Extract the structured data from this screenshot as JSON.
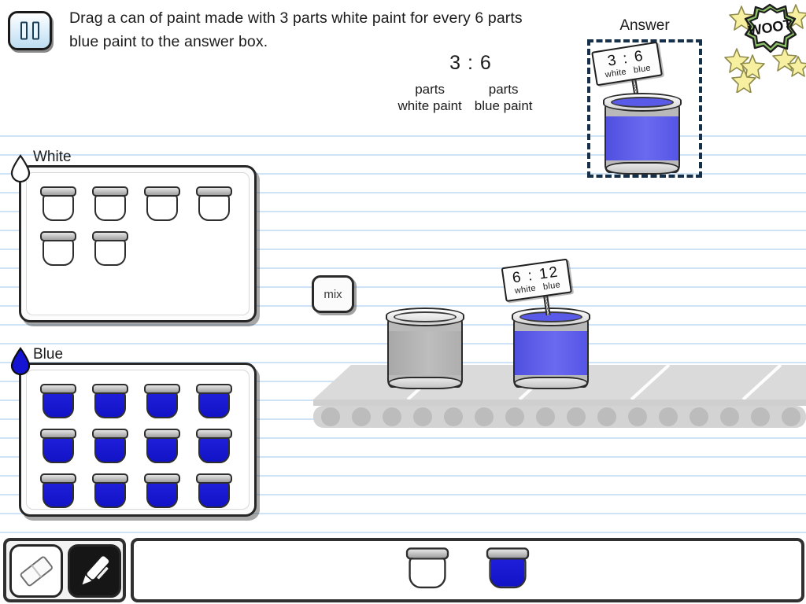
{
  "header": {
    "pause_icon": "pause-icon",
    "instruction": "Drag a can of paint made with 3 parts white paint for every 6 parts blue paint to the answer box.",
    "ratio": {
      "value": "3 : 6",
      "left_label_line1": "parts",
      "left_label_line2": "white paint",
      "right_label_line1": "parts",
      "right_label_line2": "blue paint"
    }
  },
  "answer": {
    "label": "Answer",
    "can": {
      "fill": "blue",
      "sign_nums": "3 : 6",
      "sign_left_label": "white",
      "sign_right_label": "blue"
    }
  },
  "badge": {
    "text": "WOOT",
    "star_color": "#f6ef9a"
  },
  "white_tray": {
    "title": "White",
    "drop_icon": "water-drop-outline-icon",
    "jar_count": 6,
    "jar_fill": "white"
  },
  "blue_tray": {
    "title": "Blue",
    "drop_icon": "water-drop-filled-icon",
    "jar_count": 12,
    "jar_fill": "blue"
  },
  "workspace": {
    "mix_button_label": "mix",
    "cans": [
      {
        "fill": "gray",
        "has_sign": false
      },
      {
        "fill": "blue",
        "has_sign": true,
        "sign_nums": "6 : 12",
        "sign_left_label": "white",
        "sign_right_label": "blue"
      }
    ]
  },
  "toolbar": {
    "tools": [
      {
        "name": "eraser",
        "selected": false
      },
      {
        "name": "pen",
        "selected": true
      }
    ],
    "tray_jars": [
      {
        "fill": "white"
      },
      {
        "fill": "blue"
      }
    ]
  },
  "colors": {
    "paint_blue_can": "#5a5ae8",
    "paint_blue_jar": "#1414d2",
    "paper_line": "#cfe3f7",
    "outline": "#262626"
  }
}
